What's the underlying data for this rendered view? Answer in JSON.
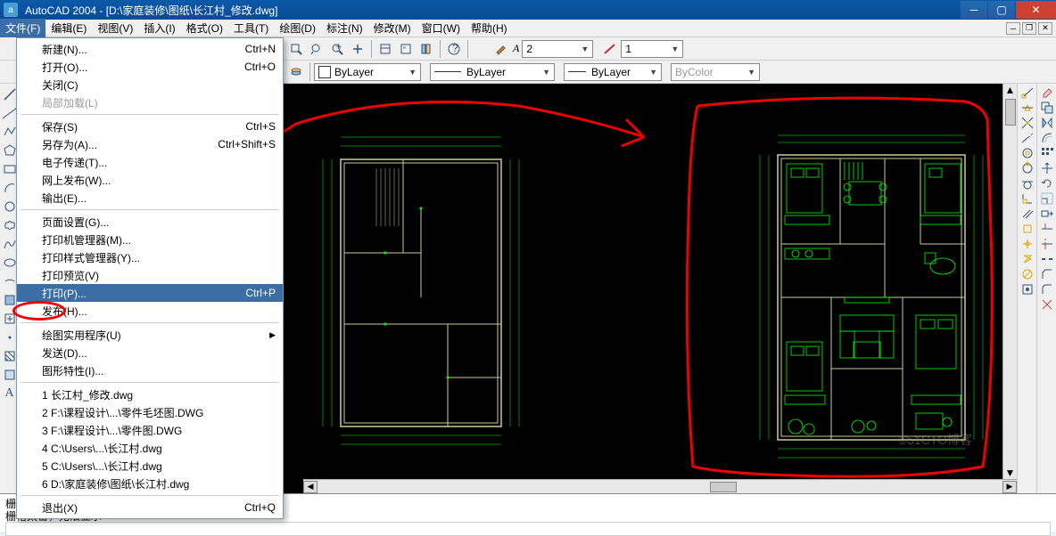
{
  "app": {
    "title": "AutoCAD 2004 - [D:\\家庭装修\\图纸\\长江村_修改.dwg]",
    "icon_text": "a"
  },
  "menubar": {
    "items": [
      "文件(F)",
      "编辑(E)",
      "视图(V)",
      "插入(I)",
      "格式(O)",
      "工具(T)",
      "绘图(D)",
      "标注(N)",
      "修改(M)",
      "窗口(W)",
      "帮助(H)"
    ]
  },
  "filemenu": {
    "group1": [
      {
        "label": "新建(N)...",
        "shortcut": "Ctrl+N"
      },
      {
        "label": "打开(O)...",
        "shortcut": "Ctrl+O"
      },
      {
        "label": "关闭(C)",
        "shortcut": ""
      },
      {
        "label": "局部加载(L)",
        "shortcut": "",
        "disabled": true
      }
    ],
    "group2": [
      {
        "label": "保存(S)",
        "shortcut": "Ctrl+S"
      },
      {
        "label": "另存为(A)...",
        "shortcut": "Ctrl+Shift+S"
      },
      {
        "label": "电子传递(T)...",
        "shortcut": ""
      },
      {
        "label": "网上发布(W)...",
        "shortcut": ""
      },
      {
        "label": "输出(E)...",
        "shortcut": ""
      }
    ],
    "group3": [
      {
        "label": "页面设置(G)...",
        "shortcut": ""
      },
      {
        "label": "打印机管理器(M)...",
        "shortcut": ""
      },
      {
        "label": "打印样式管理器(Y)...",
        "shortcut": ""
      },
      {
        "label": "打印预览(V)",
        "shortcut": ""
      },
      {
        "label": "打印(P)...",
        "shortcut": "Ctrl+P",
        "highlight": true
      },
      {
        "label": "发布(H)...",
        "shortcut": ""
      }
    ],
    "group4": [
      {
        "label": "绘图实用程序(U)",
        "shortcut": "",
        "submenu": true
      },
      {
        "label": "发送(D)...",
        "shortcut": ""
      },
      {
        "label": "图形特性(I)...",
        "shortcut": ""
      }
    ],
    "recent": [
      "1 长江村_修改.dwg",
      "2 F:\\课程设计\\...\\零件毛坯图.DWG",
      "3 F:\\课程设计\\...\\零件图.DWG",
      "4 C:\\Users\\...\\长江村.dwg",
      "5 C:\\Users\\...\\长江村.dwg",
      "6 D:\\家庭装修\\图纸\\长江村.dwg"
    ],
    "exit": {
      "label": "退出(X)",
      "shortcut": "Ctrl+Q"
    }
  },
  "toolbar2": {
    "lineweight_value": "2",
    "ltscale_value": "1"
  },
  "toolbar3": {
    "layer_combo": "ByLayer",
    "linetype_combo": "ByLayer",
    "lineweight_combo": "ByLayer",
    "color_combo": "ByColor"
  },
  "cmd": {
    "line1": "栅格太密，无法显示",
    "line2": "栅格太密，无法显示"
  },
  "watermark": "©51CTO博客",
  "colors": {
    "title_bg": "#0a5aa8",
    "menu_active": "#3a6ea5",
    "canvas": "#000000",
    "dim_green": "#00ff00",
    "wall_yellow": "#ccc088",
    "annotation_red": "#e00000"
  }
}
